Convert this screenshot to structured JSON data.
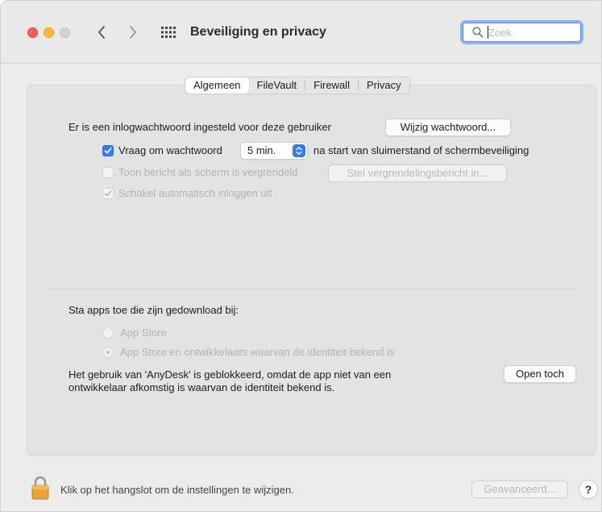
{
  "window": {
    "title": "Beveiliging en privacy",
    "search_placeholder": "Zoek"
  },
  "tabs": [
    {
      "label": "Algemeen",
      "active": true
    },
    {
      "label": "FileVault",
      "active": false
    },
    {
      "label": "Firewall",
      "active": false
    },
    {
      "label": "Privacy",
      "active": false
    }
  ],
  "general": {
    "password_set_text": "Er is een inlogwachtwoord ingesteld voor deze gebruiker",
    "change_password_button": "Wijzig wachtwoord...",
    "require_password": {
      "label": "Vraag om wachtwoord",
      "checked": true
    },
    "require_password_delay": "5 min.",
    "require_password_suffix": "na start van sluimerstand of schermbeveiliging",
    "show_message": {
      "label": "Toon bericht als scherm is vergrendeld",
      "checked": false,
      "enabled": false
    },
    "set_lock_message_button": "Stel vergrendelingsbericht in...",
    "disable_autologin": {
      "label": "Schakel automatisch inloggen uit",
      "checked": true,
      "enabled": false
    }
  },
  "downloads": {
    "heading": "Sta apps toe die zijn gedownload bij:",
    "options": [
      {
        "label": "App Store",
        "selected": false
      },
      {
        "label": "App Store en ontwikkelaars waarvan de identiteit bekend is",
        "selected": true
      }
    ],
    "blocked_message_line1": "Het gebruik van 'AnyDesk' is geblokkeerd, omdat de app niet van een",
    "blocked_message_line2": "ontwikkelaar afkomstig is waarvan de identiteit bekend is.",
    "open_anyway_button": "Open toch"
  },
  "footer": {
    "lock_text": "Klik op het hangslot om de instellingen te wijzigen.",
    "advanced_button": "Geavanceerd...",
    "help_button": "?"
  },
  "colors": {
    "accent": "#2f7cf6",
    "close": "#fe5f57",
    "minimize": "#febc2e",
    "lock": "#e8a33a"
  },
  "icons": [
    "back-chevron-icon",
    "forward-chevron-icon",
    "grid-icon",
    "search-icon",
    "lock-icon",
    "checkmark-icon",
    "stepper-icon"
  ]
}
